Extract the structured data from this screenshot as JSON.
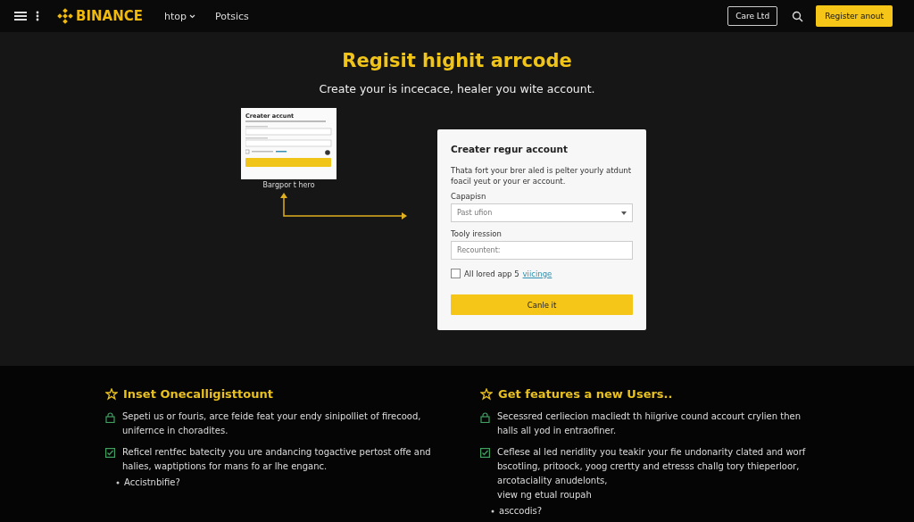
{
  "header": {
    "brand": "BINANCE",
    "nav": [
      {
        "label": "htop",
        "dropdown": true
      },
      {
        "label": "Potsics",
        "dropdown": false
      }
    ],
    "outline_button": "Care Ltd",
    "primary_button": "Register anout"
  },
  "hero": {
    "title": "Regisit highit arrcode",
    "subtitle": "Create your is incecace, healer you wite account."
  },
  "preview": {
    "title": "Creater accunt",
    "caption": "Bargpor t hero"
  },
  "form": {
    "title": "Creater regur account",
    "description": "Thata fort your brer aled is pelter yourly atdunt foacil yeut or your er account.",
    "fields": [
      {
        "kind": "select",
        "label": "Capapisn",
        "placeholder": "Past ufion"
      },
      {
        "kind": "text",
        "label": "Tooly iression",
        "placeholder": "Recountent:"
      }
    ],
    "agree": {
      "checked": false,
      "text": "All lored app 5",
      "link": "viicinge"
    },
    "submit": "Canle it"
  },
  "features": [
    {
      "title": "Inset Onecalligisttount",
      "items": [
        {
          "kind": "lock",
          "text": "Sepeti us or fouris, arce feide feat your endy sinipolliet of firecood, unifernce in choradites."
        },
        {
          "kind": "check",
          "text": "Reficel rentfec batecity you ure andancing togactive pertost offe and halies, waptiptions for mans fo ar lhe enganc."
        },
        {
          "kind": "bullet",
          "text": "Accistnbifie?"
        }
      ]
    },
    {
      "title": "Get features a new Users..",
      "items": [
        {
          "kind": "lock",
          "text": "Secessred cerliecion macliedt th hiigrive cound accourt crylien then halls all yod in entraofiner."
        },
        {
          "kind": "check",
          "text": "Ceflese al led neridlity you teakir your fie undonarity clated and worf bscotling, pritoock, yoog crertty and etresss challg tory thieperloor, arcotaciality anudelonts,\nview ng etual roupah"
        },
        {
          "kind": "bullet",
          "text": "asccodis?"
        }
      ]
    }
  ]
}
